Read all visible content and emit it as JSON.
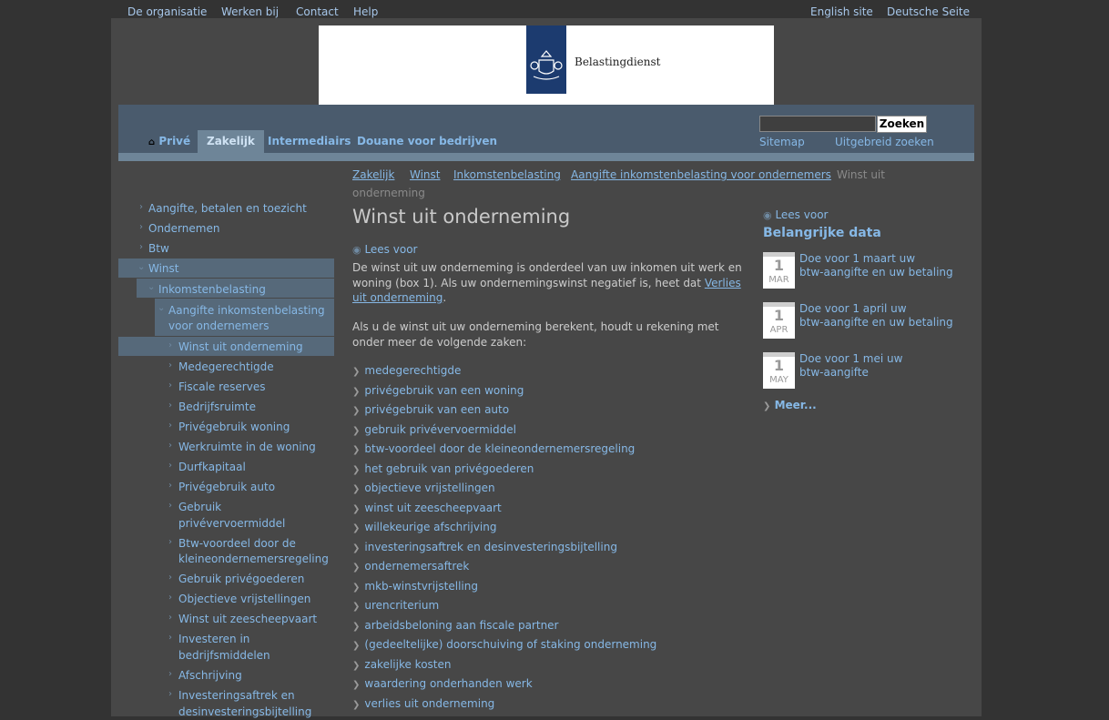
{
  "top_links": {
    "left": [
      "De organisatie",
      "Werken bij",
      "Contact",
      "Help"
    ],
    "right": [
      "English site",
      "Deutsche Seite"
    ]
  },
  "logo": {
    "text": "Belastingdienst"
  },
  "nav": {
    "tabs": [
      "Privé",
      "Zakelijk",
      "Intermediairs",
      "Douane voor bedrijven"
    ],
    "active": "Zakelijk"
  },
  "search": {
    "button": "Zoeken",
    "value": ""
  },
  "sublinks": [
    "Sitemap",
    "Uitgebreid zoeken"
  ],
  "breadcrumb": {
    "links": [
      "Zakelijk",
      "Winst",
      "Inkomstenbelasting",
      "Aangifte inkomstenbelasting voor ondernemers"
    ],
    "current_line1": "Winst uit",
    "current_line2": "onderneming"
  },
  "sidebar": {
    "items": [
      "Aangifte, betalen en toezicht",
      "Ondernemen",
      "Btw",
      "Winst",
      "Inkomstenbelasting",
      "Aangifte inkomstenbelasting",
      "voor ondernemers",
      "Winst uit onderneming",
      "Medegerechtigde",
      "Fiscale reserves",
      "Bedrijfsruimte",
      "Privégebruik woning",
      "Werkruimte in de woning",
      "Durfkapitaal",
      "Privégebruik auto",
      "Gebruik",
      "privévervoermiddel",
      "Btw-voordeel door de",
      "kleineondernemersregeling",
      "Gebruik privégoederen",
      "Objectieve vrijstellingen",
      "Winst uit zeescheepvaart",
      "Investeren in",
      "bedrijfsmiddelen",
      "Afschrijving",
      "Investeringsaftrek en",
      "desinvesteringsbijtelling"
    ]
  },
  "main": {
    "title": "Winst uit onderneming",
    "lees_voor": "Lees voor",
    "para1_a": "De winst uit uw onderneming is onderdeel van uw inkomen uit werk en woning (box 1). Als uw ondernemingswinst negatief is, heet dat ",
    "para1_link": "Verlies uit onderneming",
    "para1_b": ".",
    "para2": "Als u de winst uit uw onderneming berekent, houdt u rekening met onder meer de volgende zaken:",
    "list": [
      "medegerechtigde",
      "privégebruik van een woning",
      "privégebruik van een auto",
      "gebruik privévervoermiddel",
      "btw-voordeel door de kleineondernemersregeling",
      "het gebruik van privégoederen",
      "objectieve vrijstellingen",
      "winst uit zeescheepvaart",
      "willekeurige afschrijving",
      "investeringsaftrek en desinvesteringsbijtelling",
      "ondernemersaftrek",
      "mkb-winstvrijstelling",
      "urencriterium",
      "arbeidsbeloning aan fiscale partner",
      "(gedeeltelijke) doorschuiving of staking onderneming",
      "zakelijke kosten",
      "waardering onderhanden werk",
      "verlies uit onderneming"
    ]
  },
  "right": {
    "lees_voor": "Lees voor",
    "heading": "Belangrijke data",
    "dates": [
      {
        "day": "1",
        "month": "MAR",
        "line1": "Doe voor 1 maart uw",
        "line2": "btw-aangifte en uw betaling"
      },
      {
        "day": "1",
        "month": "APR",
        "line1": "Doe voor 1 april uw",
        "line2": "btw-aangifte en uw betaling"
      },
      {
        "day": "1",
        "month": "MAY",
        "line1": "Doe voor 1 mei uw",
        "line2": "btw-aangifte"
      }
    ],
    "meer": "Meer..."
  }
}
